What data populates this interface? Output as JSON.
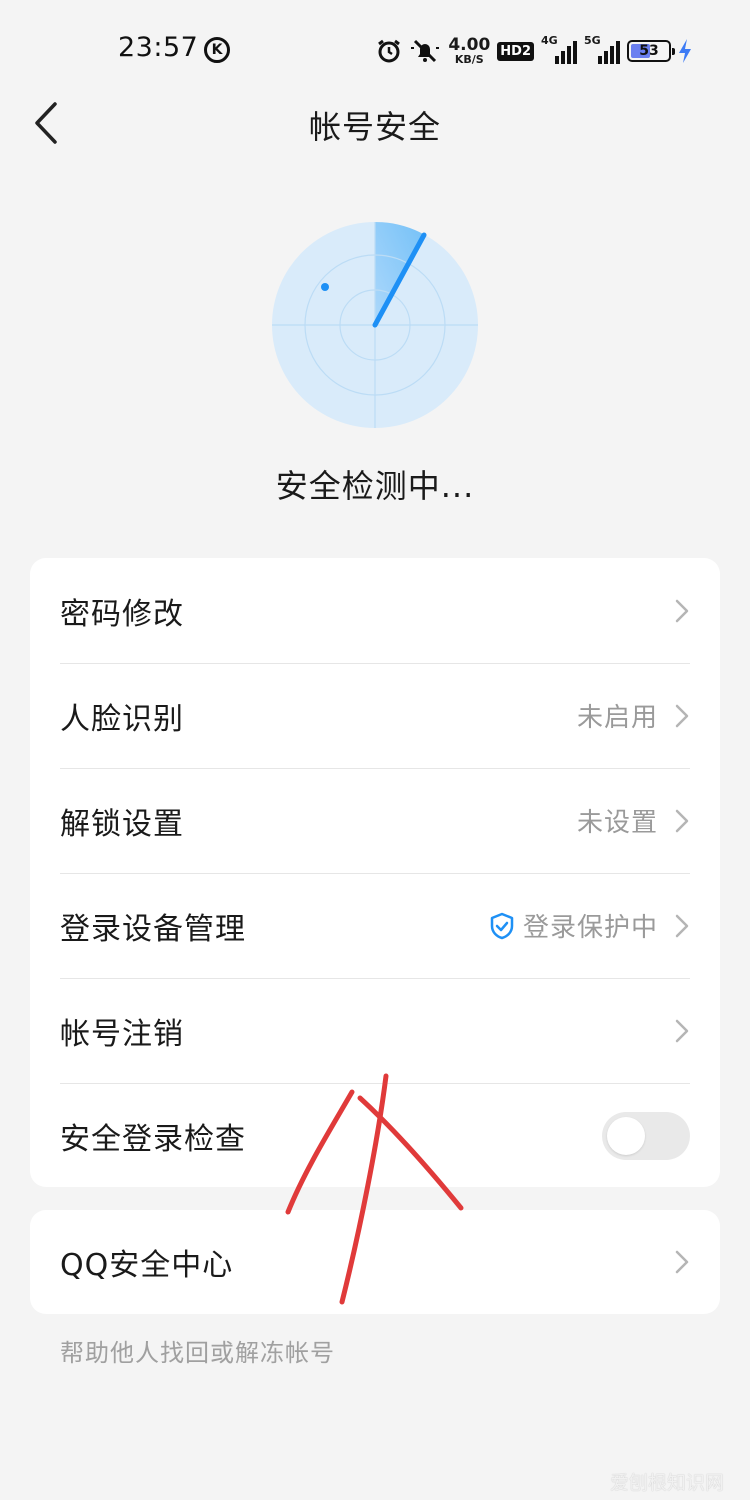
{
  "status_bar": {
    "time": "23:57",
    "k_badge": "K",
    "net_speed_value": "4.00",
    "net_speed_unit": "KB/S",
    "hd_badge": "HD2",
    "sim1_label": "4G",
    "sim2_label": "5G",
    "battery_level": "53",
    "icons": [
      "alarm-icon",
      "mute-icon",
      "signal-icon",
      "battery-icon",
      "charging-icon"
    ]
  },
  "nav": {
    "title": "帐号安全"
  },
  "radar": {
    "status_text": "安全检测中..."
  },
  "settings": [
    {
      "label": "密码修改",
      "value": ""
    },
    {
      "label": "人脸识别",
      "value": "未启用"
    },
    {
      "label": "解锁设置",
      "value": "未设置"
    },
    {
      "label": "登录设备管理",
      "value": "登录保护中"
    },
    {
      "label": "帐号注销",
      "value": ""
    },
    {
      "label": "安全登录检查",
      "toggle_on": false
    }
  ],
  "qq_center": {
    "label": "QQ安全中心"
  },
  "footer_note": "帮助他人找回或解冻帐号",
  "watermark": "爱刨根知识网",
  "colors": {
    "accent": "#1e90f5",
    "background": "#f4f4f4",
    "annotation": "#e03a3a"
  }
}
